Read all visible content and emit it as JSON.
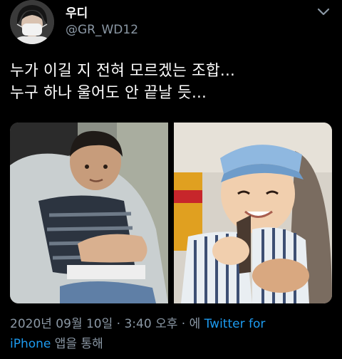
{
  "tweet": {
    "display_name": "우디",
    "handle": "@GR_WD12",
    "text_lines": [
      "누가 이길 지 전혀 모르겠는 조합...",
      "누구 하나 울어도 안 끝날 듯..."
    ],
    "media": [
      {
        "icon": "photo-child-held-icon"
      },
      {
        "icon": "photo-child-toy-gun-icon"
      }
    ],
    "meta": {
      "date": "2020년 09월 10일",
      "sep1": " · ",
      "time": "3:40 오후",
      "sep2": " · ",
      "via_prefix": "에 ",
      "source_part1": "Twitter for",
      "source_part2": "iPhone",
      "via_suffix": " 앱을 통해"
    }
  },
  "colors": {
    "background": "#000000",
    "text": "#ffffff",
    "secondary": "#8b98a5",
    "link": "#1d9bf0"
  }
}
